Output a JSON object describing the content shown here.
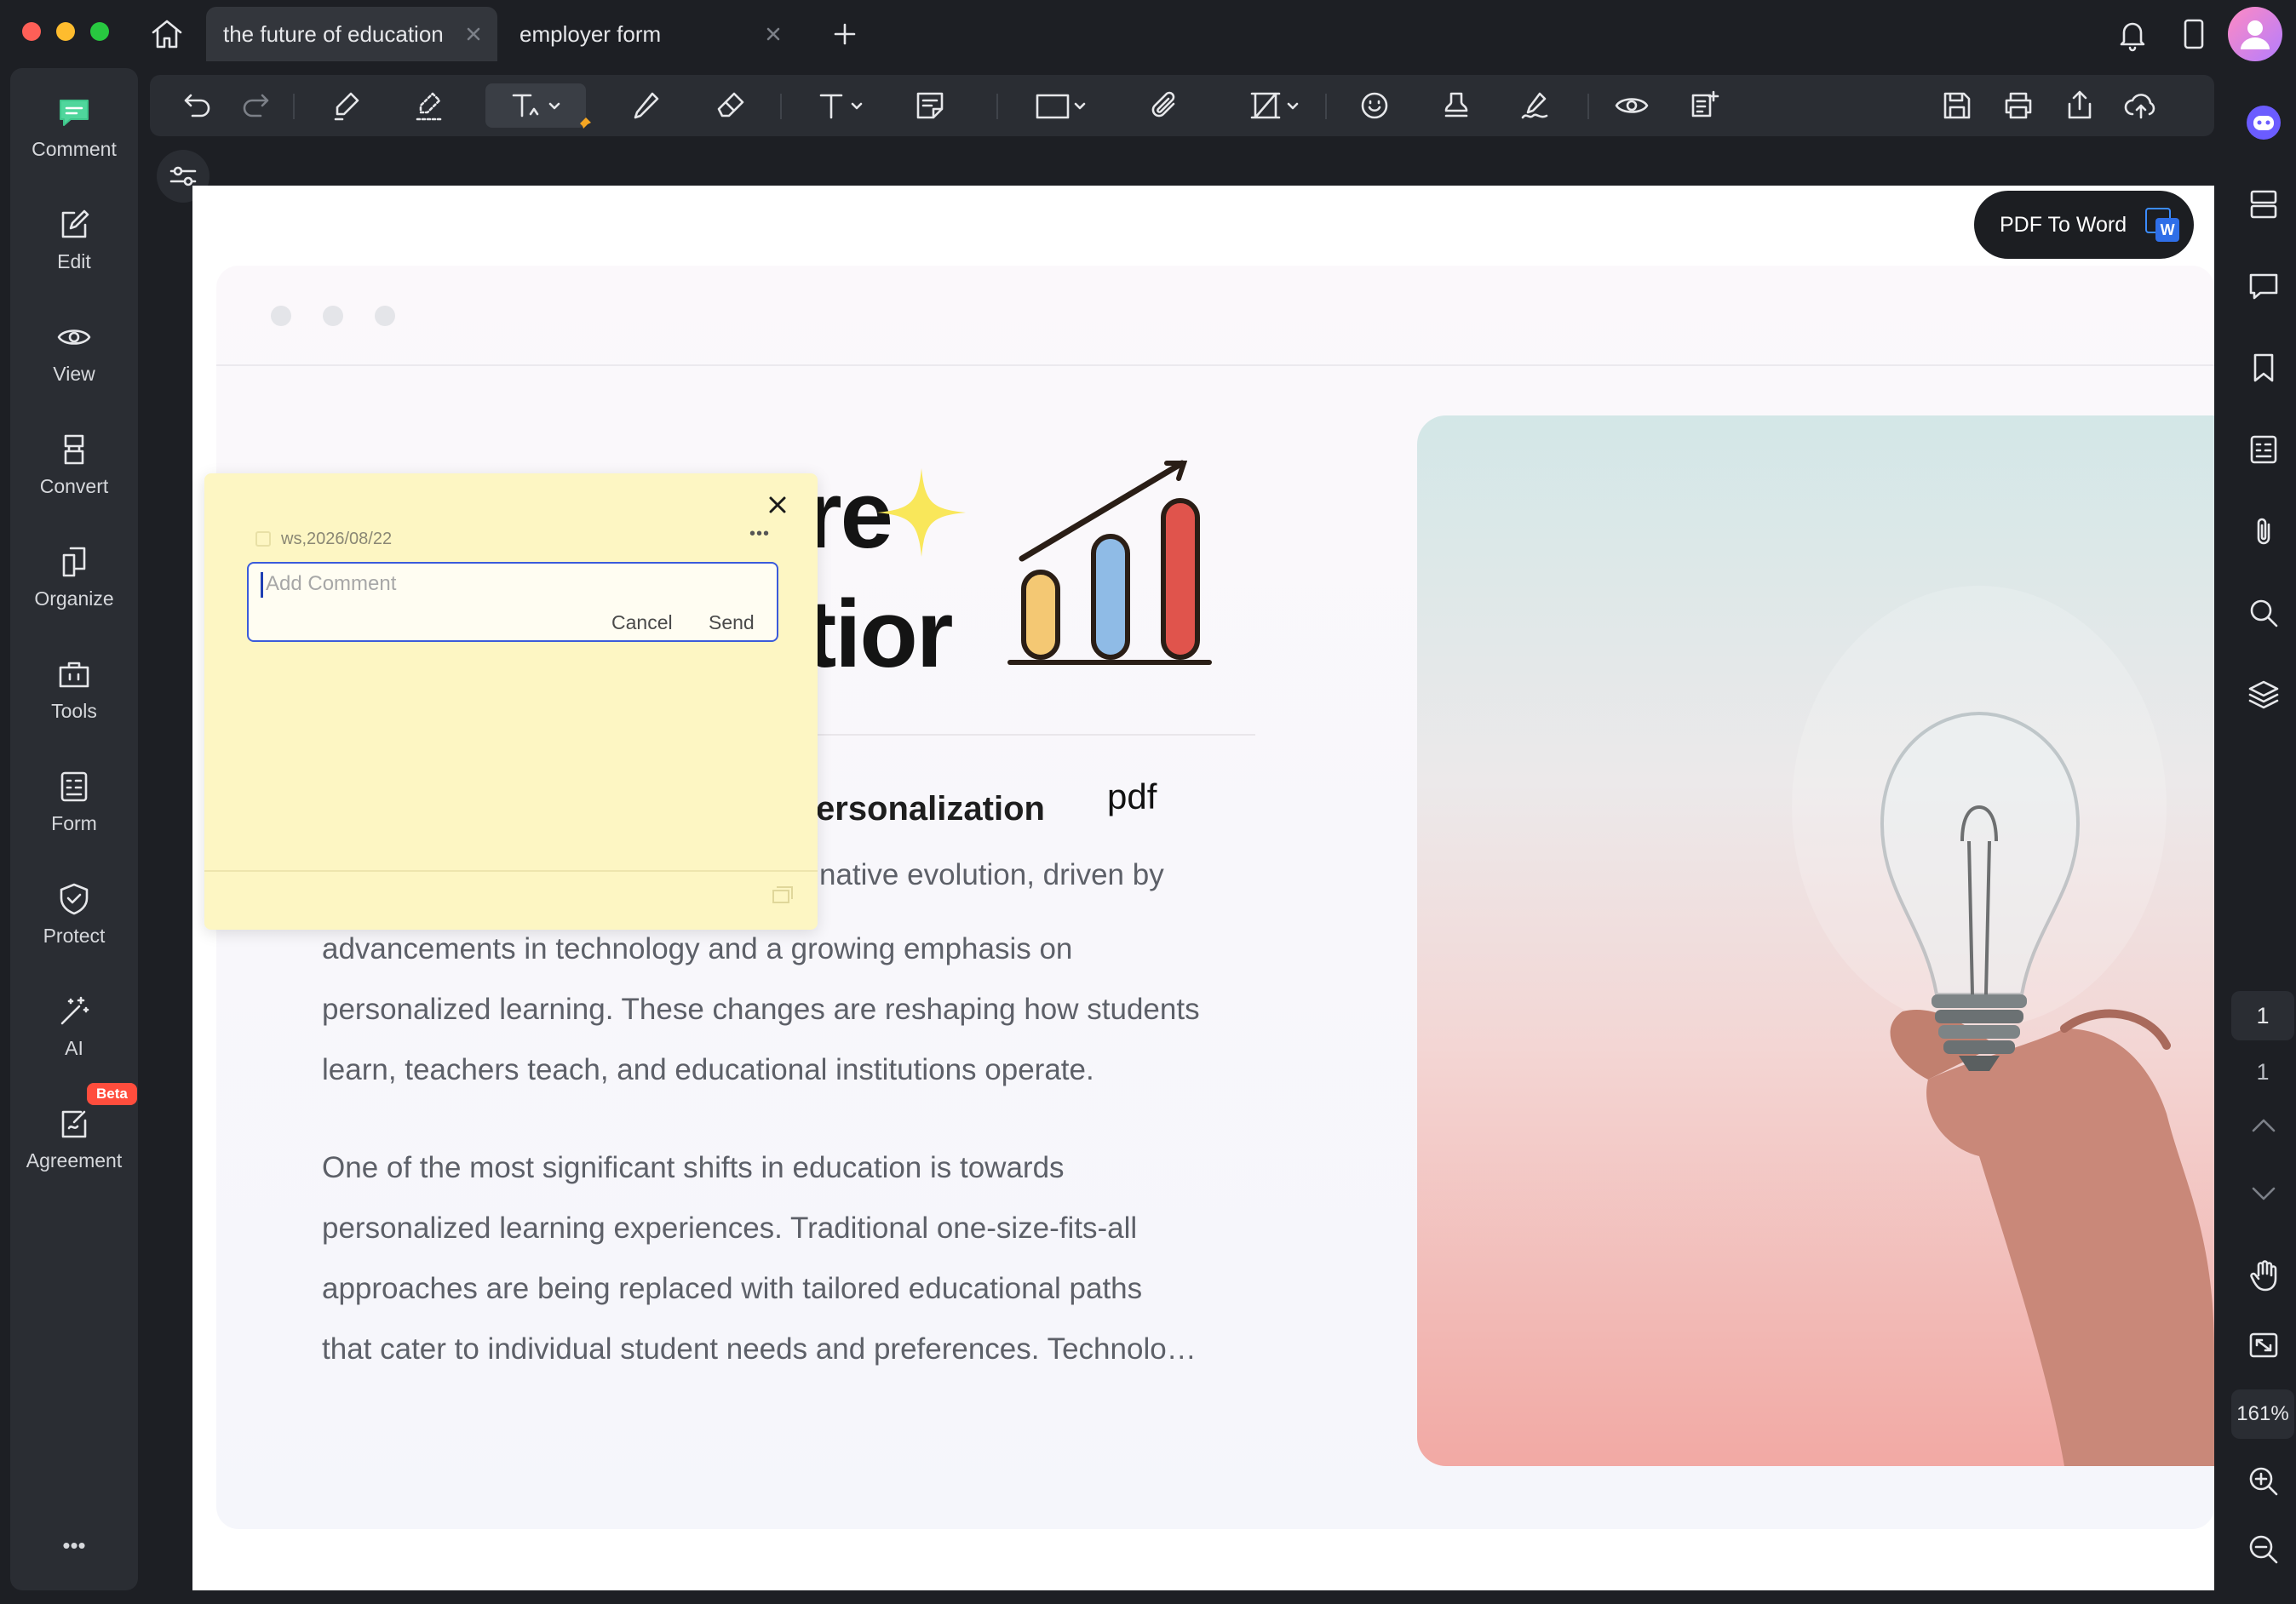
{
  "tabs": [
    {
      "label": "the future of education",
      "active": true
    },
    {
      "label": "employer form",
      "active": false
    }
  ],
  "left_rail": [
    {
      "label": "Comment",
      "icon": "comment-icon"
    },
    {
      "label": "Edit",
      "icon": "edit-icon"
    },
    {
      "label": "View",
      "icon": "view-icon"
    },
    {
      "label": "Convert",
      "icon": "convert-icon"
    },
    {
      "label": "Organize",
      "icon": "organize-icon"
    },
    {
      "label": "Tools",
      "icon": "tools-icon"
    },
    {
      "label": "Form",
      "icon": "form-icon"
    },
    {
      "label": "Protect",
      "icon": "protect-icon"
    },
    {
      "label": "AI",
      "icon": "ai-wand-icon"
    },
    {
      "label": "Agreement",
      "icon": "agreement-icon",
      "badge": "Beta"
    }
  ],
  "more_label": "•••",
  "pdf_to_word": {
    "label": "PDF To Word",
    "badge": "W"
  },
  "document": {
    "title_line1_fragment": "re",
    "title_line2_fragment": "tior",
    "subtitle_fragment": "ersonalization",
    "pdf_label": "pdf",
    "para1_line1_fragment": "native evolution, driven by",
    "para1_lines": [
      "advancements in technology and a growing emphasis on",
      "personalized learning. These changes are reshaping how students",
      "learn, teachers teach, and educational institutions operate."
    ],
    "para2_lines": [
      "One of the most significant shifts in education is towards",
      "personalized learning experiences. Traditional one-size-fits-all",
      "approaches are being replaced with tailored educational paths",
      "that cater to individual student needs and preferences. Technolo…"
    ]
  },
  "comment_popup": {
    "author_date": "ws,2026/08/22",
    "menu": "•••",
    "placeholder": "Add Comment",
    "cancel_label": "Cancel",
    "send_label": "Send"
  },
  "page_nav": {
    "current": "1",
    "total": "1"
  },
  "zoom": "161%",
  "colors": {
    "app_bg": "#1d1f24",
    "panel_bg": "#2a2d33",
    "note_bg": "#fdf6c3",
    "accent_blue": "#3b5bdb",
    "beta_badge": "#ff4d3d",
    "bar_yellow": "#f4c873",
    "bar_blue": "#8fbbe6",
    "bar_red": "#e0544c"
  }
}
